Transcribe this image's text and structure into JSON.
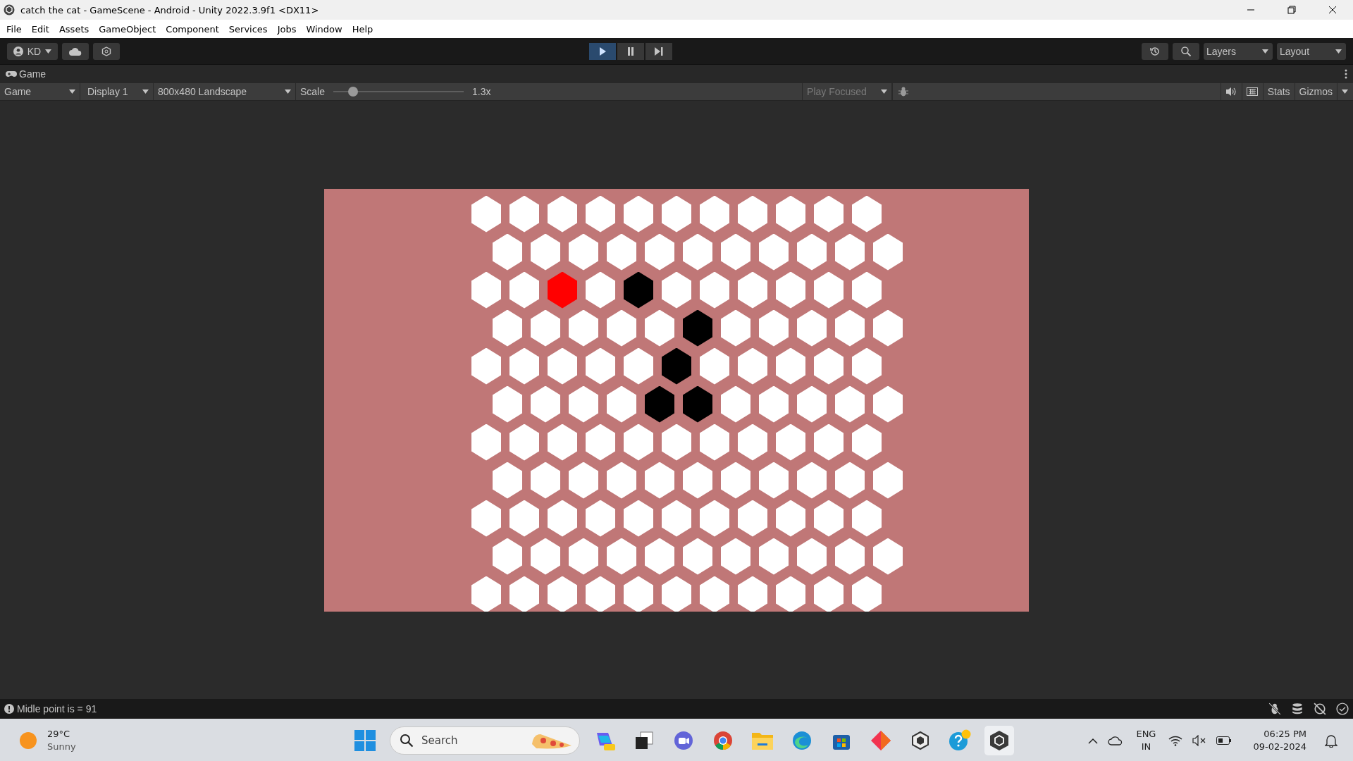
{
  "window": {
    "title": "catch the cat - GameScene - Android - Unity 2022.3.9f1 <DX11>"
  },
  "menu": [
    "File",
    "Edit",
    "Assets",
    "GameObject",
    "Component",
    "Services",
    "Jobs",
    "Window",
    "Help"
  ],
  "toolbar": {
    "account": "KD",
    "playing": true,
    "layers": "Layers",
    "layout": "Layout"
  },
  "panel": {
    "tab": "Game"
  },
  "game_toolbar": {
    "view": "Game",
    "display": "Display 1",
    "resolution": "800x480 Landscape",
    "scale_label": "Scale",
    "scale": {
      "level": 0.15
    },
    "scale_reading": "1.3x",
    "play_mode": "Play Focused",
    "stats": "Stats",
    "gizmos": "Gizmos"
  },
  "board": {
    "rows": [
      {
        "cells": [
          {
            "color": "#ffffff"
          },
          {
            "color": "#ffffff"
          },
          {
            "color": "#ffffff"
          },
          {
            "color": "#ffffff"
          },
          {
            "color": "#ffffff"
          },
          {
            "color": "#ffffff"
          },
          {
            "color": "#ffffff"
          },
          {
            "color": "#ffffff"
          },
          {
            "color": "#ffffff"
          },
          {
            "color": "#ffffff"
          },
          {
            "color": "#ffffff"
          }
        ]
      },
      {
        "cells": [
          {
            "color": "#ffffff"
          },
          {
            "color": "#ffffff"
          },
          {
            "color": "#ffffff"
          },
          {
            "color": "#ffffff"
          },
          {
            "color": "#ffffff"
          },
          {
            "color": "#ffffff"
          },
          {
            "color": "#ffffff"
          },
          {
            "color": "#ffffff"
          },
          {
            "color": "#ffffff"
          },
          {
            "color": "#ffffff"
          },
          {
            "color": "#ffffff"
          }
        ]
      },
      {
        "cells": [
          {
            "color": "#ffffff"
          },
          {
            "color": "#ffffff"
          },
          {
            "color": "#ff0000"
          },
          {
            "color": "#ffffff"
          },
          {
            "color": "#000000"
          },
          {
            "color": "#ffffff"
          },
          {
            "color": "#ffffff"
          },
          {
            "color": "#ffffff"
          },
          {
            "color": "#ffffff"
          },
          {
            "color": "#ffffff"
          },
          {
            "color": "#ffffff"
          }
        ]
      },
      {
        "cells": [
          {
            "color": "#ffffff"
          },
          {
            "color": "#ffffff"
          },
          {
            "color": "#ffffff"
          },
          {
            "color": "#ffffff"
          },
          {
            "color": "#ffffff"
          },
          {
            "color": "#000000"
          },
          {
            "color": "#ffffff"
          },
          {
            "color": "#ffffff"
          },
          {
            "color": "#ffffff"
          },
          {
            "color": "#ffffff"
          },
          {
            "color": "#ffffff"
          }
        ]
      },
      {
        "cells": [
          {
            "color": "#ffffff"
          },
          {
            "color": "#ffffff"
          },
          {
            "color": "#ffffff"
          },
          {
            "color": "#ffffff"
          },
          {
            "color": "#ffffff"
          },
          {
            "color": "#000000"
          },
          {
            "color": "#ffffff"
          },
          {
            "color": "#ffffff"
          },
          {
            "color": "#ffffff"
          },
          {
            "color": "#ffffff"
          },
          {
            "color": "#ffffff"
          }
        ]
      },
      {
        "cells": [
          {
            "color": "#ffffff"
          },
          {
            "color": "#ffffff"
          },
          {
            "color": "#ffffff"
          },
          {
            "color": "#ffffff"
          },
          {
            "color": "#000000"
          },
          {
            "color": "#000000"
          },
          {
            "color": "#ffffff"
          },
          {
            "color": "#ffffff"
          },
          {
            "color": "#ffffff"
          },
          {
            "color": "#ffffff"
          },
          {
            "color": "#ffffff"
          }
        ]
      },
      {
        "cells": [
          {
            "color": "#ffffff"
          },
          {
            "color": "#ffffff"
          },
          {
            "color": "#ffffff"
          },
          {
            "color": "#ffffff"
          },
          {
            "color": "#ffffff"
          },
          {
            "color": "#ffffff"
          },
          {
            "color": "#ffffff"
          },
          {
            "color": "#ffffff"
          },
          {
            "color": "#ffffff"
          },
          {
            "color": "#ffffff"
          },
          {
            "color": "#ffffff"
          }
        ]
      },
      {
        "cells": [
          {
            "color": "#ffffff"
          },
          {
            "color": "#ffffff"
          },
          {
            "color": "#ffffff"
          },
          {
            "color": "#ffffff"
          },
          {
            "color": "#ffffff"
          },
          {
            "color": "#ffffff"
          },
          {
            "color": "#ffffff"
          },
          {
            "color": "#ffffff"
          },
          {
            "color": "#ffffff"
          },
          {
            "color": "#ffffff"
          },
          {
            "color": "#ffffff"
          }
        ]
      },
      {
        "cells": [
          {
            "color": "#ffffff"
          },
          {
            "color": "#ffffff"
          },
          {
            "color": "#ffffff"
          },
          {
            "color": "#ffffff"
          },
          {
            "color": "#ffffff"
          },
          {
            "color": "#ffffff"
          },
          {
            "color": "#ffffff"
          },
          {
            "color": "#ffffff"
          },
          {
            "color": "#ffffff"
          },
          {
            "color": "#ffffff"
          },
          {
            "color": "#ffffff"
          }
        ]
      },
      {
        "cells": [
          {
            "color": "#ffffff"
          },
          {
            "color": "#ffffff"
          },
          {
            "color": "#ffffff"
          },
          {
            "color": "#ffffff"
          },
          {
            "color": "#ffffff"
          },
          {
            "color": "#ffffff"
          },
          {
            "color": "#ffffff"
          },
          {
            "color": "#ffffff"
          },
          {
            "color": "#ffffff"
          },
          {
            "color": "#ffffff"
          },
          {
            "color": "#ffffff"
          }
        ]
      },
      {
        "cells": [
          {
            "color": "#ffffff"
          },
          {
            "color": "#ffffff"
          },
          {
            "color": "#ffffff"
          },
          {
            "color": "#ffffff"
          },
          {
            "color": "#ffffff"
          },
          {
            "color": "#ffffff"
          },
          {
            "color": "#ffffff"
          },
          {
            "color": "#ffffff"
          },
          {
            "color": "#ffffff"
          },
          {
            "color": "#ffffff"
          },
          {
            "color": "#ffffff"
          }
        ]
      }
    ]
  },
  "status_bar": {
    "message": "Midle point is = 91"
  },
  "taskbar": {
    "weather": {
      "temperature": "29°C",
      "condition": "Sunny"
    },
    "search": {
      "placeholder": "Search"
    },
    "language": "ENG",
    "region": "IN",
    "time": "06:25 PM",
    "date": "09-02-2024"
  }
}
